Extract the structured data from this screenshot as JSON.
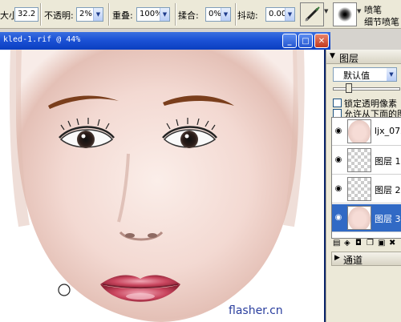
{
  "toolbar": {
    "size_label": "大小",
    "size_value": "32.2",
    "opacity_label": "不透明:",
    "opacity_value": "2%",
    "overlay_label": "重叠:",
    "overlay_value": "100%",
    "blend_label": "揉合:",
    "blend_value": "0%",
    "jitter_label": "抖动:",
    "jitter_value": "0.00",
    "brush_name_line1": "喷笔",
    "brush_name_line2": "细节喷笔"
  },
  "document": {
    "title": "kled-1.rif @ 44%",
    "watermark": "flasher.cn",
    "minimize_label": "_",
    "maximize_label": "□",
    "close_label": "✕"
  },
  "layers_panel": {
    "title": "图层",
    "blend_mode": "默认值",
    "lock_transparency_label": "锁定透明像素",
    "pick_below_label": "允许从下面的图层",
    "layers": [
      {
        "name": "ljx_072...",
        "thumb": "face",
        "selected": false
      },
      {
        "name": "图层 1",
        "thumb": "empty",
        "selected": false
      },
      {
        "name": "图层 2",
        "thumb": "empty",
        "selected": false
      },
      {
        "name": "图层 3",
        "thumb": "face",
        "selected": true
      }
    ]
  },
  "channels_panel": {
    "title": "通道"
  },
  "icons": {
    "brush_tool": "airbrush-icon",
    "brush_tip": "brush-tip-icon",
    "eye": "eye-icon",
    "collapse": "triangle-down-icon",
    "expand": "triangle-right-icon"
  }
}
